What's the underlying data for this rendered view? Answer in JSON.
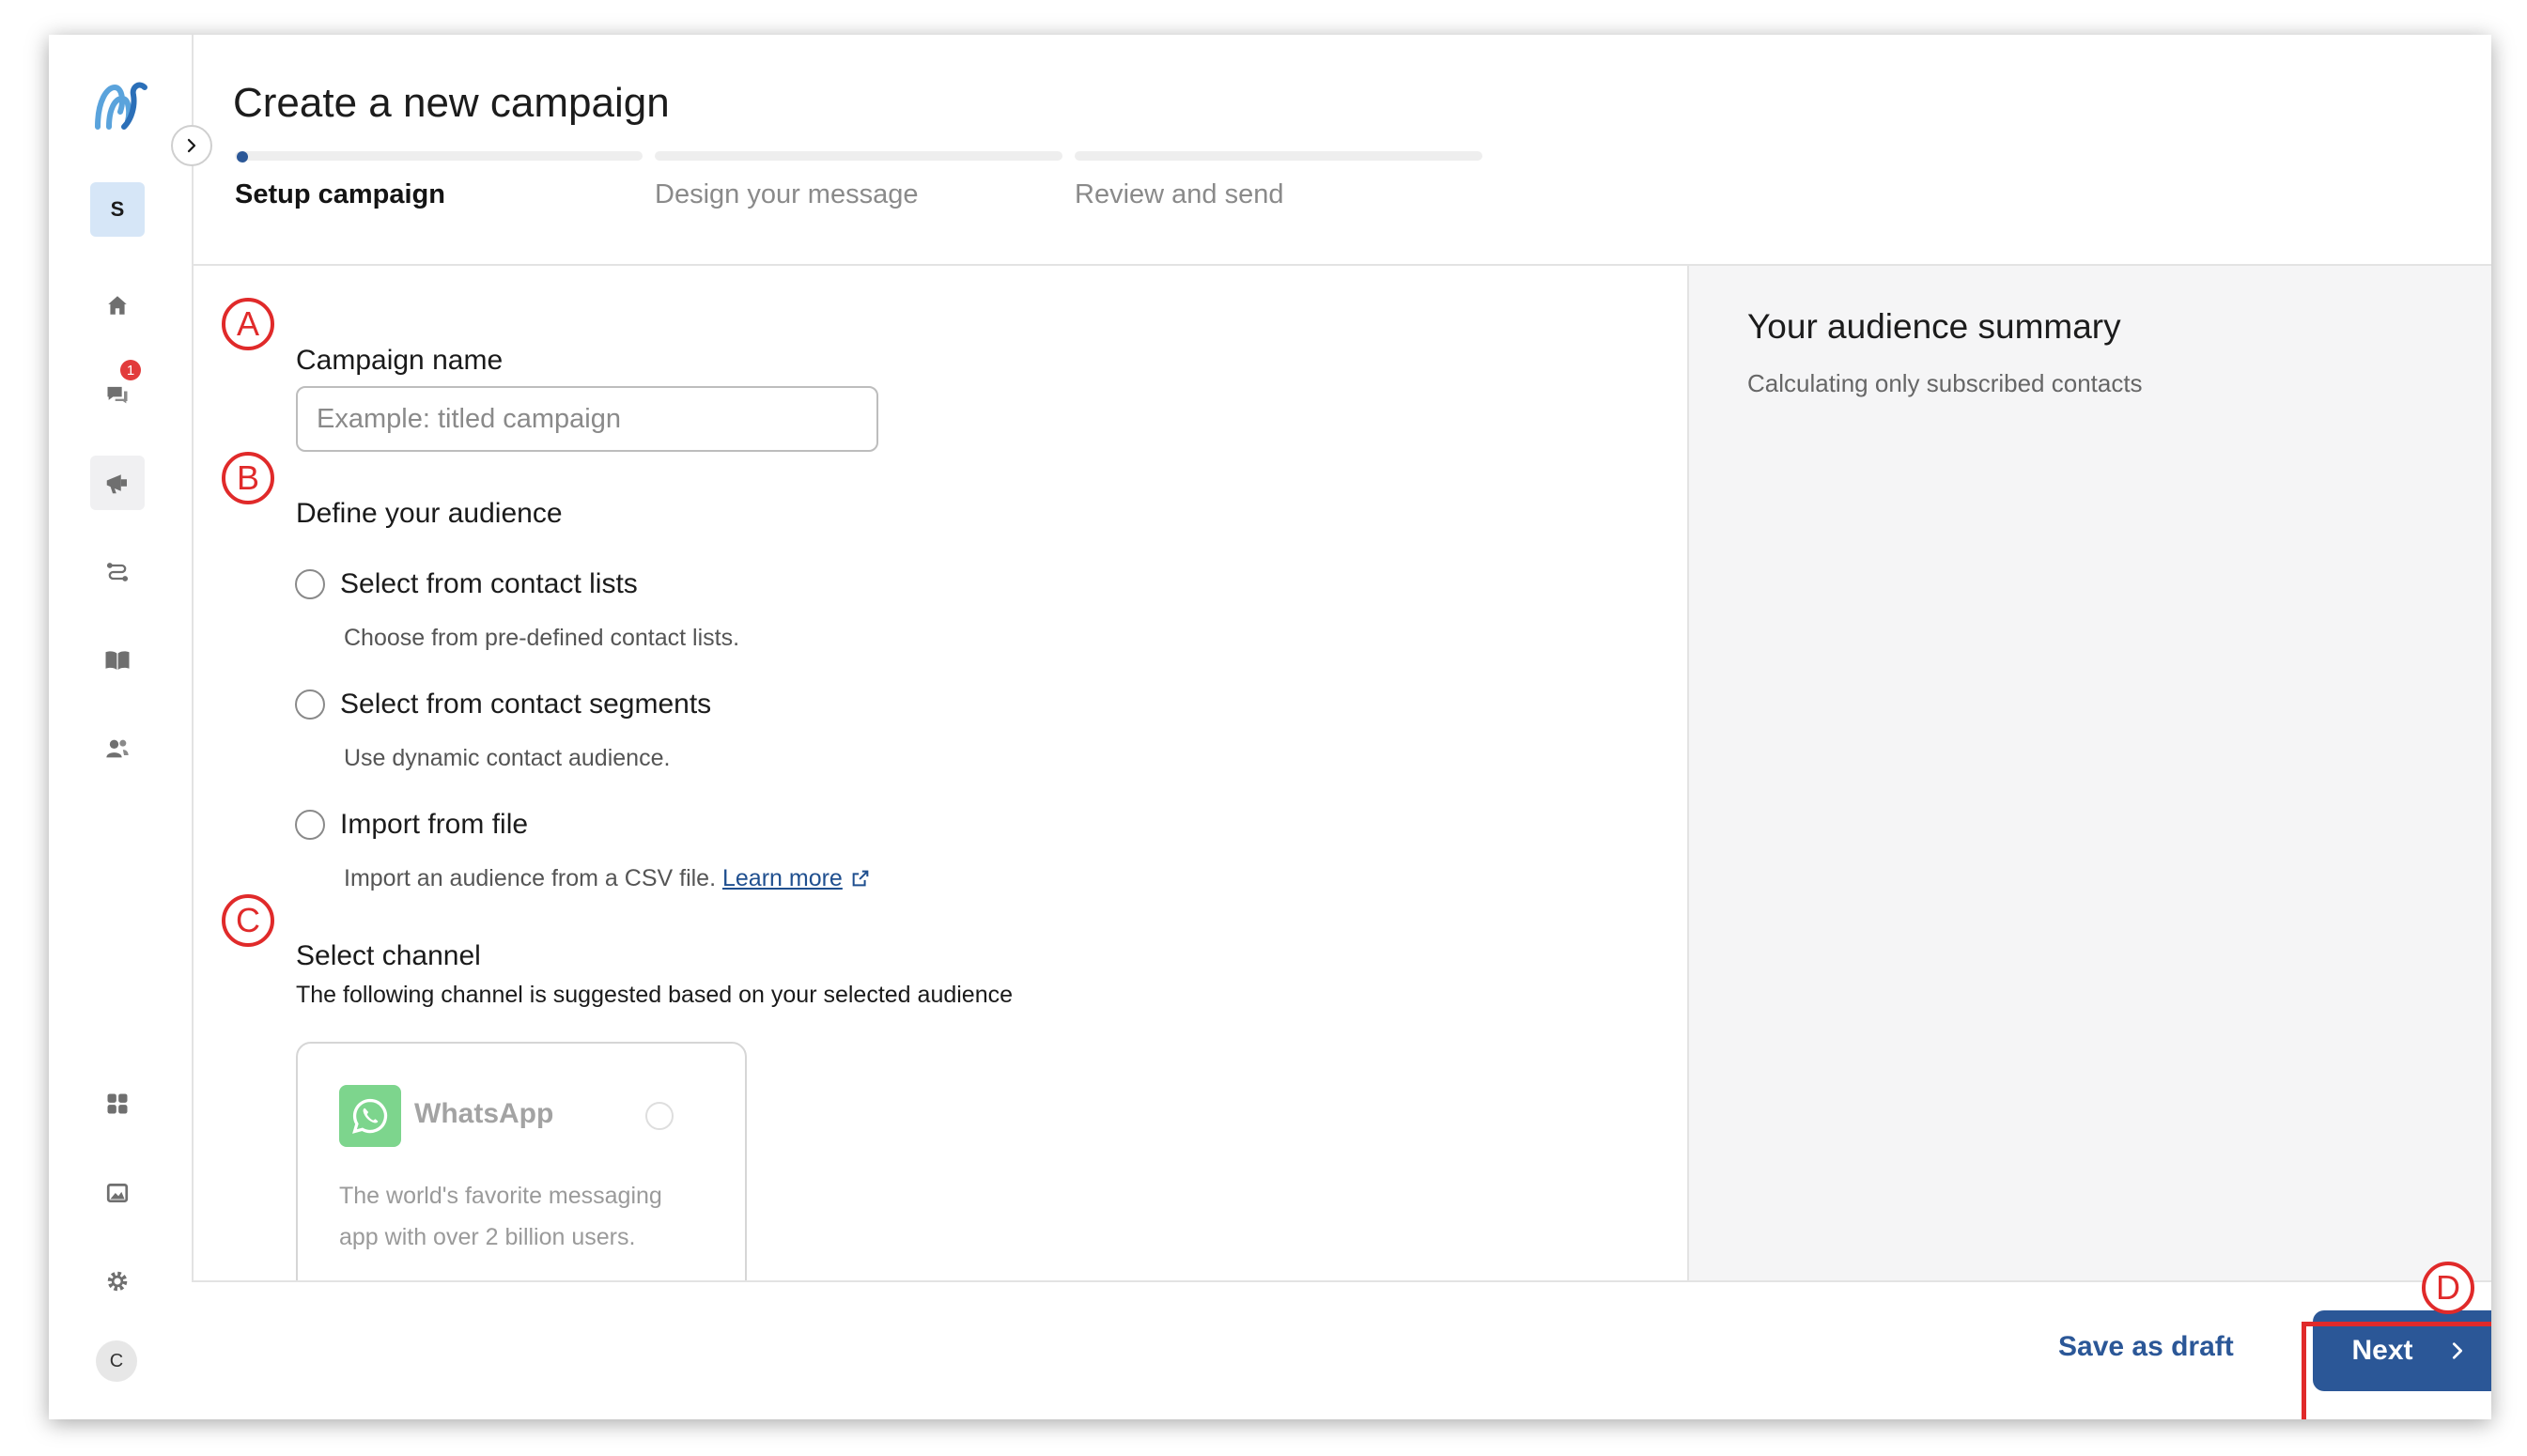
{
  "app": {
    "workspace_initial": "S",
    "user_initial": "C",
    "notification_count": "1"
  },
  "header": {
    "title": "Create a new campaign",
    "steps": [
      {
        "label": "Setup campaign",
        "active": true
      },
      {
        "label": "Design your message",
        "active": false
      },
      {
        "label": "Review and send",
        "active": false
      }
    ]
  },
  "form": {
    "campaign_name": {
      "marker": "A",
      "label": "Campaign name",
      "placeholder": "Example: titled campaign",
      "value": ""
    },
    "audience": {
      "marker": "B",
      "label": "Define your audience",
      "options": [
        {
          "label": "Select from contact lists",
          "description": "Choose from pre-defined contact lists."
        },
        {
          "label": "Select from contact segments",
          "description": "Use dynamic contact audience."
        },
        {
          "label": "Import from file",
          "description": "Import an audience from a CSV file.",
          "link": "Learn more"
        }
      ]
    },
    "channel": {
      "marker": "C",
      "label": "Select channel",
      "hint": "The following channel is suggested based on your selected audience",
      "card": {
        "name": "WhatsApp",
        "description": "The world's favorite messaging app with over 2 billion users."
      }
    }
  },
  "summary": {
    "title": "Your audience summary",
    "subtitle": "Calculating only subscribed contacts"
  },
  "footer": {
    "save_draft": "Save as draft",
    "next": "Next",
    "next_marker": "D"
  },
  "colors": {
    "primary": "#2b5797",
    "annotation": "#e02a2a",
    "whatsapp": "#7dd58d"
  },
  "icons": [
    "logo-icon",
    "home-icon",
    "chat-icon",
    "megaphone-icon",
    "journey-icon",
    "book-icon",
    "contacts-icon",
    "apps-icon",
    "image-icon",
    "gear-icon",
    "chevron-right-icon",
    "whatsapp-icon",
    "external-link-icon"
  ]
}
